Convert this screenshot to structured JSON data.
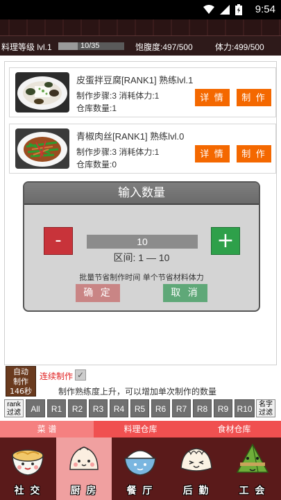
{
  "status_bar": {
    "time": "9:54"
  },
  "level_bar": {
    "level_label": "料理等级 lvl.1",
    "xp_text": "10/35",
    "xp_progress": 0.29,
    "satiety": "饱腹度:497/500",
    "stamina": "体力:499/500"
  },
  "recipes": [
    {
      "name": "皮蛋拌豆腐[RANK1]  熟练lvl.1",
      "steps_cost": "制作步骤:3  消耗体力:1",
      "stock": "仓库数量:1",
      "detail_label": "详 情",
      "make_label": "制 作",
      "image": "preserved-egg-tofu"
    },
    {
      "name": "青椒肉丝[RANK1]  熟练lvl.0",
      "steps_cost": "制作步骤:3  消耗体力:1",
      "stock": "仓库数量:0",
      "detail_label": "详 情",
      "make_label": "制 作",
      "image": "pepper-pork-strips"
    }
  ],
  "dialog": {
    "title": "输入数量",
    "minus": "-",
    "plus": "+",
    "quantity": "10",
    "range": "区间: 1 — 10",
    "tips": "批量节省制作时间    单个节省材料体力",
    "ok": "确 定",
    "cancel": "取 消"
  },
  "auto_make": {
    "line1": "自动",
    "line2": "制作",
    "line3": "146秒"
  },
  "continuous": {
    "label": "连续制作",
    "checked": true,
    "check_mark": "✓"
  },
  "hint": "制作熟练度上升，可以增加单次制作的数量",
  "filters": {
    "rank_label_1": "rank",
    "rank_label_2": "过滤",
    "buttons": [
      "All",
      "R1",
      "R2",
      "R3",
      "R4",
      "R5",
      "R6",
      "R7",
      "R8",
      "R9",
      "R10"
    ],
    "name_label_1": "名字",
    "name_label_2": "过滤"
  },
  "tabs": [
    "菜 谱",
    "料理仓库",
    "食材仓库"
  ],
  "nav": [
    {
      "label": "社 交",
      "icon": "noodle-bowl-mascot-icon"
    },
    {
      "label": "厨 房",
      "icon": "bun-mascot-icon"
    },
    {
      "label": "餐 厅",
      "icon": "rice-bowl-mascot-icon"
    },
    {
      "label": "后 勤",
      "icon": "dumpling-mascot-icon"
    },
    {
      "label": "工 会",
      "icon": "zongzi-mascot-icon"
    }
  ]
}
